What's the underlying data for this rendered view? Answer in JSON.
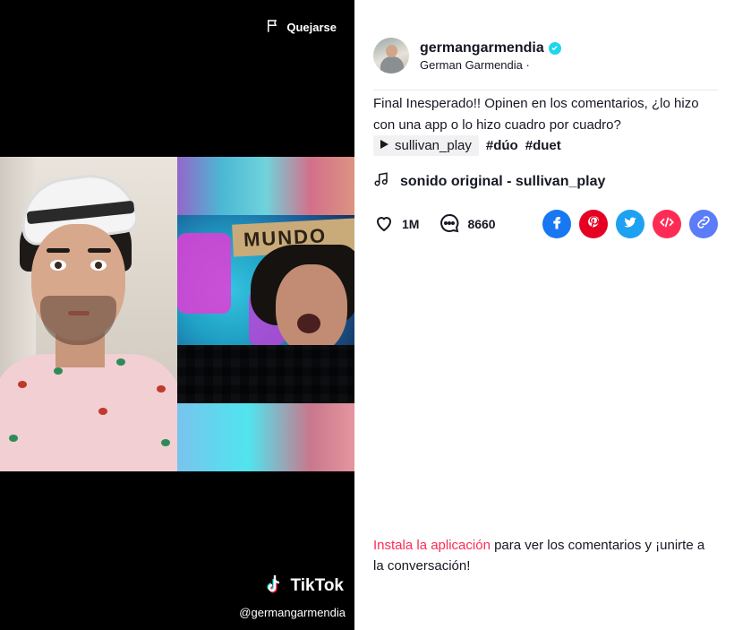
{
  "video": {
    "report_label": "Quejarse",
    "watermark_brand": "TikTok",
    "watermark_handle": "@germangarmendia",
    "sign_text": "MUNDO"
  },
  "author": {
    "username": "germangarmendia",
    "nickname": "German Garmendia ·",
    "verified": true
  },
  "post": {
    "caption": "Final Inesperado!! Opinen en los comentarios, ¿lo hizo con una app o lo hizo cuadro por cuadro?",
    "duet_with": "sullivan_play",
    "hashtags": [
      "#dúo",
      "#duet"
    ],
    "sound": "sonido original - sullivan_play"
  },
  "stats": {
    "likes": "1M",
    "comments": "8660"
  },
  "share_icons": [
    {
      "name": "facebook-icon",
      "color": "#1877f2"
    },
    {
      "name": "pinterest-icon",
      "color": "#e60023"
    },
    {
      "name": "twitter-icon",
      "color": "#1da1f2"
    },
    {
      "name": "embed-icon",
      "color": "#fe2c55"
    },
    {
      "name": "link-icon",
      "color": "#5c7cfa"
    }
  ],
  "install_prompt": {
    "link_text": "Instala la aplicación",
    "rest_text": " para ver los comentarios y ¡unirte a la conversación!"
  },
  "colors": {
    "accent": "#fe2c55",
    "verified": "#20d5ec",
    "text": "#161823"
  }
}
